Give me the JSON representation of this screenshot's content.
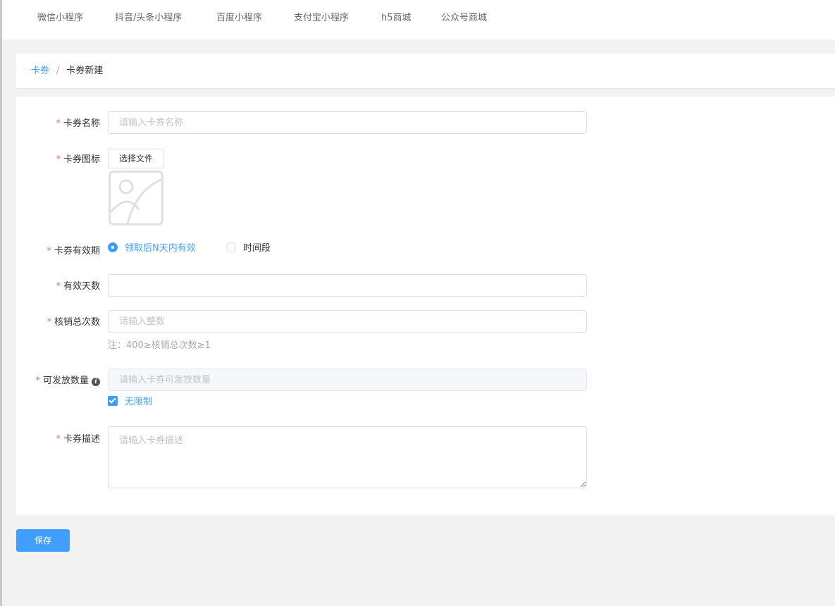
{
  "tabs": [
    {
      "label": "微信小程序"
    },
    {
      "label": "抖音/头条小程序"
    },
    {
      "label": "百度小程序"
    },
    {
      "label": "支付宝小程序"
    },
    {
      "label": "h5商城"
    },
    {
      "label": "公众号商城"
    }
  ],
  "breadcrumb": {
    "parent": "卡券",
    "separator": "/",
    "current": "卡券新建"
  },
  "form": {
    "required_mark": "*",
    "name": {
      "label": "卡券名称",
      "placeholder": "请输入卡券名称",
      "value": ""
    },
    "icon": {
      "label": "卡券图标",
      "button": "选择文件"
    },
    "validity": {
      "label": "卡券有效期",
      "options": [
        {
          "label": "领取后N天内有效",
          "selected": true
        },
        {
          "label": "时间段",
          "selected": false
        }
      ]
    },
    "days": {
      "label": "有效天数",
      "value": ""
    },
    "uses": {
      "label": "核销总次数",
      "placeholder": "请输入整数",
      "value": "",
      "hint": "注：400≥核销总次数≥1"
    },
    "quantity": {
      "label": "可发放数量",
      "placeholder": "请输入卡券可发放数量",
      "value": "",
      "disabled": true,
      "info_icon": "i"
    },
    "unlimited": {
      "label": "无限制",
      "checked": true
    },
    "desc": {
      "label": "卡券描述",
      "placeholder": "请输入卡券描述",
      "value": ""
    }
  },
  "save_label": "保存",
  "colors": {
    "accent": "#409eff",
    "required": "#f56c6c",
    "page_bg": "#f2f2f2"
  }
}
